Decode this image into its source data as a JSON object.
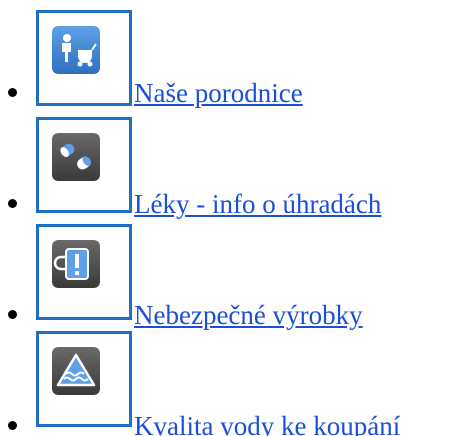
{
  "links": [
    {
      "label": "Naše porodnice",
      "icon": "maternity-icon"
    },
    {
      "label": "Léky - info o úhradách",
      "icon": "pills-icon"
    },
    {
      "label": "Nebezpečné výrobky",
      "icon": "dangerous-product-icon"
    },
    {
      "label": "Kvalita vody ke koupání",
      "icon": "water-warning-icon"
    }
  ],
  "colors": {
    "link": "#1a4fd8",
    "icon_frame": "#1f6fc4",
    "tile_blue": "#3d7fd1",
    "tile_gray": "#4d4d4d"
  }
}
